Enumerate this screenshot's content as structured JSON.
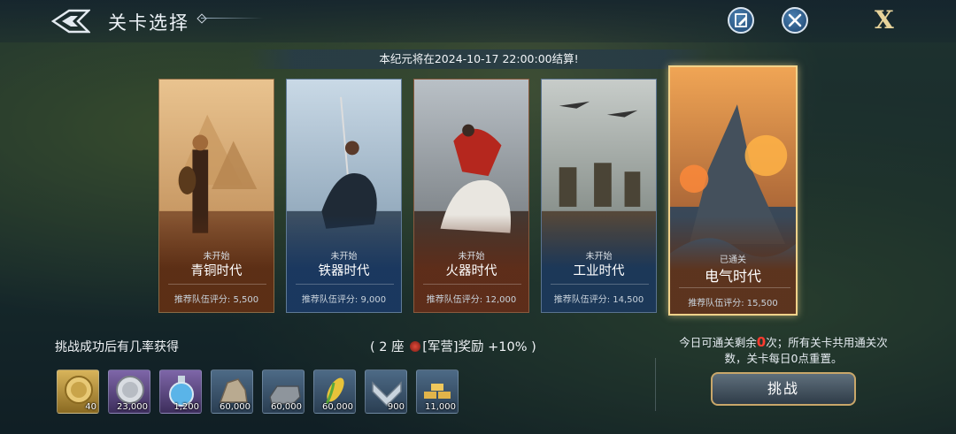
{
  "header": {
    "title": "关卡选择",
    "close_label": "X"
  },
  "notice": "本纪元将在2024-10-17 22:00:00结算!",
  "stages": [
    {
      "status": "未开始",
      "name": "青铜时代",
      "recommend": "推荐队伍评分: 5,500",
      "theme": "bronze"
    },
    {
      "status": "未开始",
      "name": "铁器时代",
      "recommend": "推荐队伍评分: 9,000",
      "theme": "iron"
    },
    {
      "status": "未开始",
      "name": "火器时代",
      "recommend": "推荐队伍评分: 12,000",
      "theme": "firearm"
    },
    {
      "status": "未开始",
      "name": "工业时代",
      "recommend": "推荐队伍评分: 14,500",
      "theme": "industrial"
    },
    {
      "status": "已通关",
      "name": "电气时代",
      "recommend": "推荐队伍评分: 15,500",
      "theme": "electric",
      "selected": true
    }
  ],
  "rewards": {
    "title": "挑战成功后有几率获得",
    "bonus_prefix": "( 2 座",
    "bonus_tag": "[军营]奖励",
    "bonus_pct": "+10%",
    "bonus_suffix": ")",
    "items": [
      {
        "icon": "gold-coin-icon",
        "qty": "40"
      },
      {
        "icon": "silver-coin-icon",
        "qty": "23,000"
      },
      {
        "icon": "potion-flask-icon",
        "qty": "1,200"
      },
      {
        "icon": "stone-ore-icon",
        "qty": "60,000"
      },
      {
        "icon": "iron-ingot-icon",
        "qty": "60,000"
      },
      {
        "icon": "corn-icon",
        "qty": "60,000"
      },
      {
        "icon": "rank-emblem-icon",
        "qty": "900"
      },
      {
        "icon": "gold-bars-icon",
        "qty": "11,000"
      }
    ]
  },
  "limit": {
    "line1_prefix": "今日可通关剩余",
    "remaining": "0",
    "line1_suffix": "次；所有关卡共用通关次",
    "line2": "数，关卡每日0点重置。"
  },
  "challenge_label": "挑战",
  "colors": {
    "accent_gold": "#f1d28a",
    "remaining_red": "#ff3b2f"
  }
}
